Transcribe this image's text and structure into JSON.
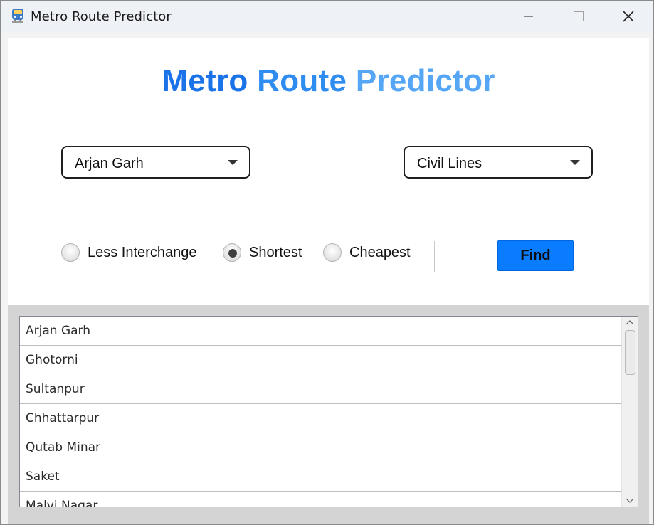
{
  "window": {
    "title": "Metro Route Predictor",
    "icon": "metro-train-icon"
  },
  "header": {
    "title_word1": "Metro",
    "title_word2": "Route",
    "title_word3": "Predictor"
  },
  "route": {
    "source": "Arjan Garh",
    "destination": "Civil Lines"
  },
  "options": {
    "less_interchange": "Less Interchange",
    "shortest": "Shortest",
    "cheapest": "Cheapest",
    "selected": "Shortest"
  },
  "actions": {
    "find_label": "Find"
  },
  "results": {
    "stations": [
      "Arjan Garh",
      "Ghotorni",
      "Sultanpur",
      "Chhattarpur",
      "Qutab Minar",
      "Saket",
      "Malvi Nagar"
    ]
  },
  "colors": {
    "heading_1": "#1a73e8",
    "heading_2": "#2f8cf0",
    "heading_3": "#56a6f6",
    "find_button": "#0a7cff"
  }
}
